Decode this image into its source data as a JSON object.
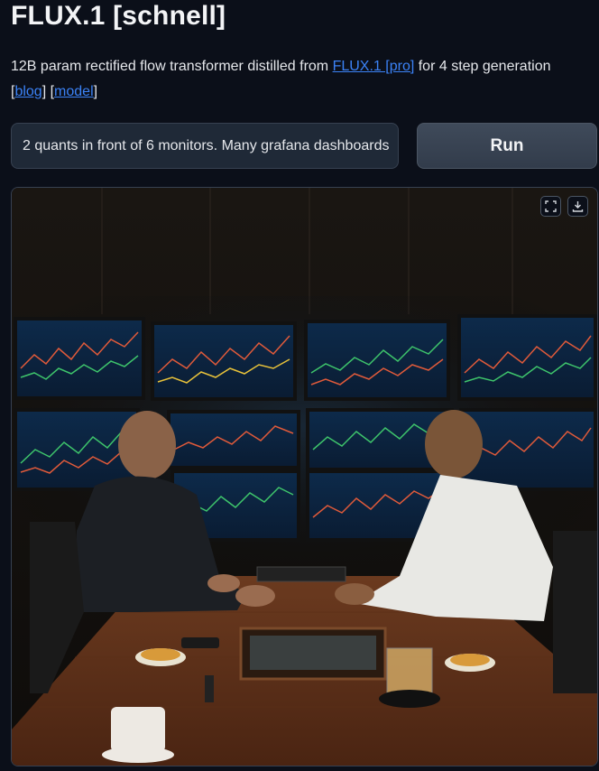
{
  "header": {
    "title": "FLUX.1 [schnell]",
    "desc_prefix": "12B param rectified flow transformer distilled from ",
    "desc_link": "FLUX.1 [pro]",
    "desc_suffix": " for 4 step generation",
    "open_bracket_1": "[",
    "blog_link": "blog",
    "mid_brackets": "] [",
    "model_link": "model",
    "close_bracket": "]"
  },
  "prompt": {
    "value": "2 quants in front of 6 monitors. Many grafana dashboards"
  },
  "run_button": {
    "label": "Run"
  },
  "image_panel": {
    "fullscreen_icon": "fullscreen-icon",
    "download_icon": "download-icon"
  },
  "colors": {
    "background": "#0b0f19",
    "link": "#3b82f6",
    "input_bg": "#1f2937",
    "button_bg": "#374151"
  }
}
